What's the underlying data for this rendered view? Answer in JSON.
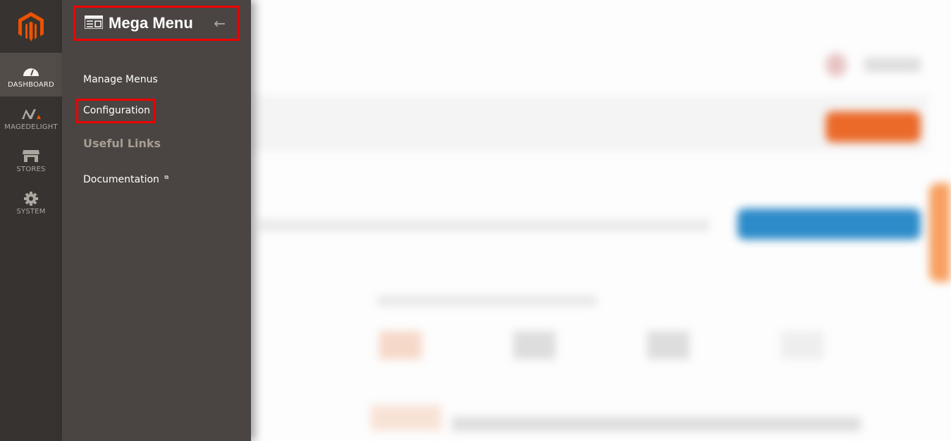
{
  "nav": {
    "logo": "magento-logo",
    "items": [
      {
        "label": "DASHBOARD",
        "icon": "dashboard-icon",
        "active": true
      },
      {
        "label": "MAGEDELIGHT",
        "icon": "magedelight-icon",
        "active": false
      },
      {
        "label": "STORES",
        "icon": "stores-icon",
        "active": false
      },
      {
        "label": "SYSTEM",
        "icon": "gear-icon",
        "active": false
      }
    ]
  },
  "panel": {
    "title": "Mega Menu",
    "title_icon": "mega-menu-icon",
    "back_icon": "back-arrow-icon",
    "items": [
      {
        "label": "Manage Menus"
      },
      {
        "label": "Configuration"
      },
      {
        "label": "Useful Links",
        "type": "group"
      },
      {
        "label": "Documentation",
        "external": true
      }
    ]
  },
  "colors": {
    "nav_bg": "#373330",
    "panel_bg": "#4a4542",
    "highlight": "#ee0000",
    "brand_orange": "#eb5202",
    "blue_button": "#2d8bc9"
  }
}
